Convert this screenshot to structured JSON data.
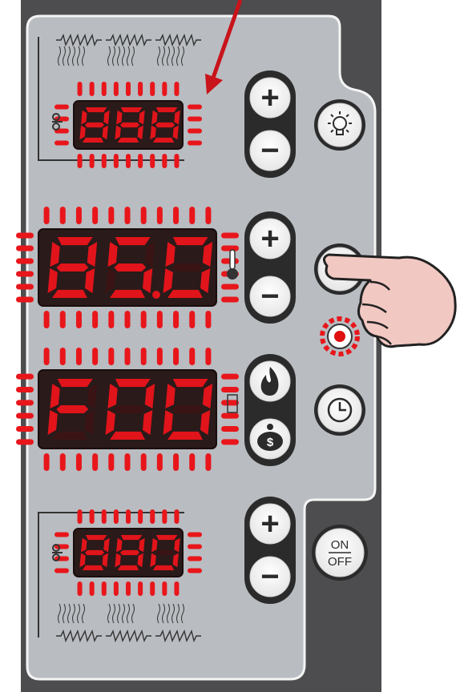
{
  "displays": [
    {
      "id": "top-oven",
      "reading": "888",
      "size": "small"
    },
    {
      "id": "temperature",
      "reading": "85.0",
      "size": "large"
    },
    {
      "id": "mode",
      "reading": "F00",
      "size": "large"
    },
    {
      "id": "bottom-oven",
      "reading": "880",
      "size": "small"
    }
  ],
  "buttons": {
    "plus": "+",
    "minus": "−",
    "on_off_top": "ON",
    "on_off_bottom": "OFF",
    "dollar": "$"
  },
  "icons": {
    "light": "lightbulb-icon",
    "fan": "fan-icon",
    "clock": "clock-icon",
    "flame": "flame-icon",
    "piggy_bank": "piggy-bank-icon",
    "thermometer": "thermometer-icon",
    "heating_element": "heating-element-icon",
    "hand": "pointing-hand-icon",
    "arrow": "arrow-icon"
  },
  "colors": {
    "panel_dark": "#4d4d4f",
    "panel_light": "#b9bcc1",
    "panel_border": "#ffffff",
    "led_on": "#e0141a",
    "led_off": "#3a1414",
    "display_bg": "#2a1a1a",
    "halo": "#e8161b",
    "skin": "#f2c8c2",
    "indicator": "#e01010"
  }
}
